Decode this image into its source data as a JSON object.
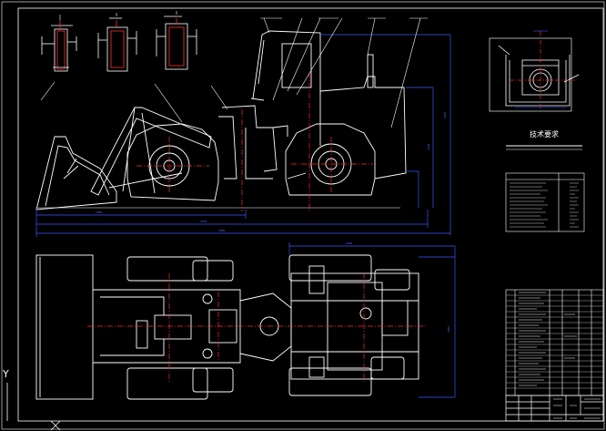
{
  "drawing": {
    "tech_requirements_title": "技术要求",
    "ucs_y_label": "Y",
    "ucs_x_label": "X"
  },
  "colors": {
    "background": "#000000",
    "outline": "#ffffff",
    "dimension": "#3a55ff",
    "centerline": "#ff2a2a",
    "leader": "#ffffff"
  }
}
